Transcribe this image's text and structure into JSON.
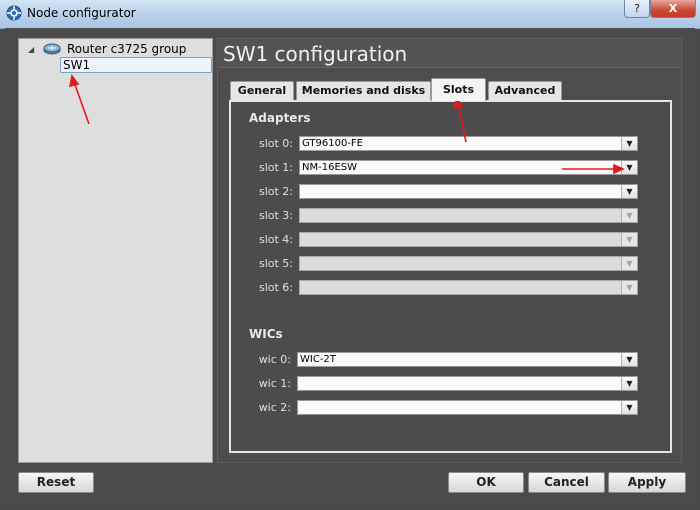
{
  "window": {
    "title": "Node configurator",
    "help_label": "?",
    "close_label": "X"
  },
  "tree": {
    "group_label": "Router c3725 group",
    "selected_item": "SW1"
  },
  "config": {
    "title": "SW1 configuration",
    "tabs": [
      {
        "label": "General",
        "active": false
      },
      {
        "label": "Memories and disks",
        "active": false
      },
      {
        "label": "Slots",
        "active": true
      },
      {
        "label": "Advanced",
        "active": false
      }
    ],
    "adapters_title": "Adapters",
    "slots": [
      {
        "label": "slot 0:",
        "value": "GT96100-FE",
        "enabled": true
      },
      {
        "label": "slot 1:",
        "value": "NM-16ESW",
        "enabled": true
      },
      {
        "label": "slot 2:",
        "value": "",
        "enabled": true
      },
      {
        "label": "slot 3:",
        "value": "",
        "enabled": false
      },
      {
        "label": "slot 4:",
        "value": "",
        "enabled": false
      },
      {
        "label": "slot 5:",
        "value": "",
        "enabled": false
      },
      {
        "label": "slot 6:",
        "value": "",
        "enabled": false
      }
    ],
    "wics_title": "WICs",
    "wics": [
      {
        "label": "wic 0:",
        "value": "WIC-2T"
      },
      {
        "label": "wic 1:",
        "value": ""
      },
      {
        "label": "wic 2:",
        "value": ""
      }
    ]
  },
  "buttons": {
    "reset": "Reset",
    "ok": "OK",
    "cancel": "Cancel",
    "apply": "Apply"
  },
  "colors": {
    "annotation": "#e31b1b",
    "panel_bg": "#4b4b4b",
    "tree_bg": "#dedede"
  }
}
